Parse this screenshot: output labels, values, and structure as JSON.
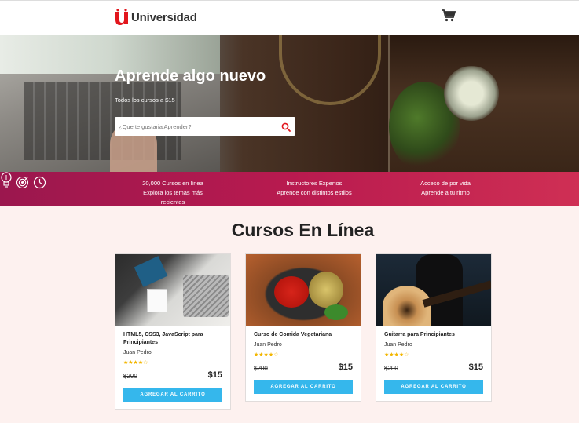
{
  "brand": {
    "letter": "u",
    "name": "Universidad"
  },
  "hero": {
    "title": "Aprende algo nuevo",
    "subtitle": "Todos los cursos a $15",
    "search_placeholder": "¿Que te gustaria Aprender?"
  },
  "features": [
    {
      "icon": "lightbulb-icon",
      "line1": "20,000 Cursos en línea",
      "line2": "Explora los temas más recientes"
    },
    {
      "icon": "target-icon",
      "line1": "Instructores Expertos",
      "line2": "Aprende con distintos estilos"
    },
    {
      "icon": "clock-icon",
      "line1": "Acceso de por vida",
      "line2": "Aprende a tu ritmo"
    }
  ],
  "section_title": "Cursos En Línea",
  "courses": [
    {
      "title": "HTML5, CSS3, JavaScript para Principiantes",
      "author": "Juan Pedro",
      "stars": "★★★★☆",
      "old_price": "$200",
      "price": "$15",
      "button": "AGREGAR AL CARRITO",
      "image": "code-books-laptop"
    },
    {
      "title": "Curso de Comida Vegetariana",
      "author": "Juan Pedro",
      "stars": "★★★★☆",
      "old_price": "$200",
      "price": "$15",
      "button": "AGREGAR AL CARRITO",
      "image": "vegetables-pan"
    },
    {
      "title": "Guitarra para Principiantes",
      "author": "Juan Pedro",
      "stars": "★★★★☆",
      "old_price": "$200",
      "price": "$15",
      "button": "AGREGAR AL CARRITO",
      "image": "guitar-player"
    }
  ],
  "colors": {
    "brand_red": "#e2151c",
    "features_gradient_start": "#9b174e",
    "features_gradient_end": "#cf2f54",
    "button_blue": "#35b7ec",
    "star": "#f2b600",
    "page_bg": "#fdf1ef"
  }
}
